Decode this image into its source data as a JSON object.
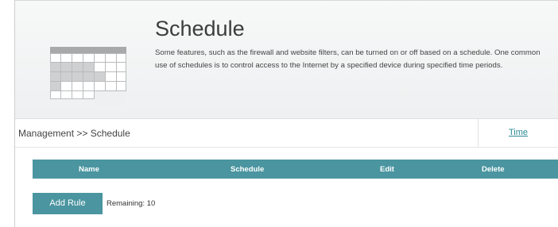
{
  "header": {
    "title": "Schedule",
    "description": "Some features, such as the firewall and website filters, can be turned on or off based on a schedule. One common use of schedules is to control access to the Internet by a specified device during specified time periods.",
    "icon": "calendar-icon"
  },
  "breadcrumb": {
    "text": "Management >> Schedule"
  },
  "tabs": {
    "time_label": "Time"
  },
  "table": {
    "columns": [
      "Name",
      "Schedule",
      "Edit",
      "Delete"
    ],
    "rows": []
  },
  "actions": {
    "add_rule_label": "Add Rule",
    "remaining_text": "Remaining: 10"
  },
  "colors": {
    "accent": "#4a95a0",
    "link": "#2b8a96"
  }
}
